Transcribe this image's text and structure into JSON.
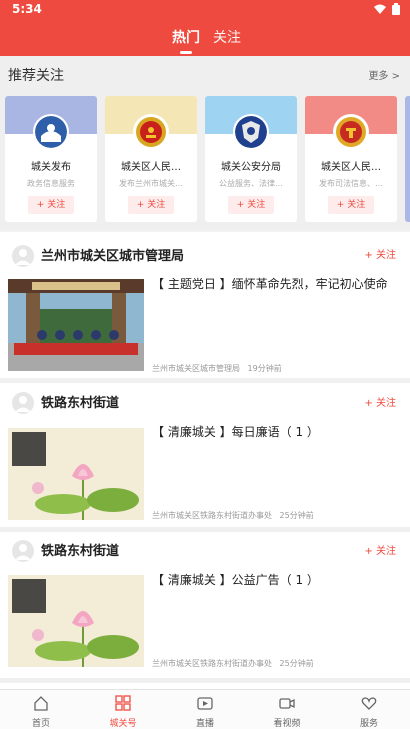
{
  "status_bar": {
    "time": "5:34"
  },
  "top_tabs": [
    {
      "label": "热门"
    },
    {
      "label": "关注"
    }
  ],
  "recommend": {
    "title": "推荐关注",
    "more": "更多 >",
    "cards": [
      {
        "name": "城关发布",
        "desc": "政务信息服务",
        "follow": "+ 关注",
        "banner_color": "#a9b6e3"
      },
      {
        "name": "城关区人民…",
        "desc": "发布兰州市城关…",
        "follow": "+ 关注",
        "banner_color": "#f5e6b6"
      },
      {
        "name": "城关公安分局",
        "desc": "公益服务、法律…",
        "follow": "+ 关注",
        "banner_color": "#9fd3f2"
      },
      {
        "name": "城关区人民…",
        "desc": "发布司法信息、…",
        "follow": "+ 关注",
        "banner_color": "#f28a85"
      }
    ]
  },
  "feed": [
    {
      "author": "兰州市城关区城市管理局",
      "follow": "+ 关注",
      "title": "【 主题党日 】缅怀革命先烈，牢记初心使命",
      "source": "兰州市城关区城市管理局",
      "time": "19分钟前"
    },
    {
      "author": "铁路东村街道",
      "follow": "+ 关注",
      "title": "【 清廉城关 】每日廉语（ 1 ）",
      "source": "兰州市城关区铁路东村街道办事处",
      "time": "25分钟前"
    },
    {
      "author": "铁路东村街道",
      "follow": "+ 关注",
      "title": "【 清廉城关 】公益广告（ 1 ）",
      "source": "兰州市城关区铁路东村街道办事处",
      "time": "25分钟前"
    }
  ],
  "bottom_nav": [
    {
      "label": "首页",
      "icon": "home-icon",
      "active": false
    },
    {
      "label": "城关号",
      "icon": "grid-icon",
      "active": true
    },
    {
      "label": "直播",
      "icon": "tv-icon",
      "active": false
    },
    {
      "label": "看视频",
      "icon": "video-camera-icon",
      "active": false
    },
    {
      "label": "服务",
      "icon": "heart-icon",
      "active": false
    }
  ],
  "colors": {
    "brand": "#ef4a3f"
  }
}
